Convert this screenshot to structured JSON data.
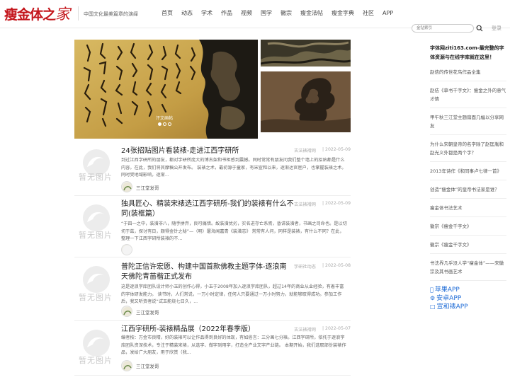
{
  "header": {
    "logo_main": "瘦金体之",
    "logo_ka": "家",
    "tagline": "中国文化最美篇章的演绎",
    "nav": [
      "首页",
      "动态",
      "学术",
      "作品",
      "视频",
      "国学",
      "徽宗",
      "瘦金法帖",
      "瘦金字典",
      "社区",
      "APP"
    ],
    "search_placeholder": "金钻索引",
    "login": "登录"
  },
  "banner": {
    "caption": "汗文画帖"
  },
  "articles": [
    {
      "title": "24张招贴图片看装裱-走进江西字研所",
      "source": "古法裱褙网",
      "date": "| 2022-05-09",
      "excerpt": "到过江西字研所的朋友，都对字研所庞大的博古架和书柜感到震撼。同时常常有朋友问我们整个墙上的招贴都是什么内容。在此，我们将其摩稿公开发布。 装裱之术，最初源于童家，有宋宣和以来，逐渐达官宦户，也掌握装裱之术。同时受地域影响，逐渐...",
      "author": "三江堂发哥",
      "thumb_text": "暂无图片"
    },
    {
      "title": "独具匠心、精装宋裱选江西字研所-我们的装裱有什么不同(装框篇）",
      "source": "古法裱褙网",
      "date": "| 2022-05-09",
      "excerpt": "“于四一之中，装潢非八，随手拼弃，良可痛惜。故装潢优劣，实名进存亡系焉，昏讲装潢者，书画之司命也。是以切切于兹，探讨有日，颇得金针之秘”—（明）屠海闻嘉青《装潢志》 常常有人问，同样是装裱，有什么不同？在此，整理一下江西字研所装裱的不...",
      "author": "",
      "thumb_text": "暂无图片"
    },
    {
      "title": "普陀正信许宏愿、构建中国首款佛教主题字体-逐浪南天佛陀青苗楷正式发布",
      "source": "字研社动态",
      "date": "| 2022-05-08",
      "excerpt": "这是逐浪字库团队设计师小玉的创作心得，小玉于2008年加入逐浪字库团队，超过14年的商业从业经验，有着丰富的字体研发能力。 读书时，人们常说，一万小时定律，任何人只要通过一万小时努力，就能够取得成功。参加工作后，我又听资者说“试玉能烧七日久，...",
      "author": "三江堂发哥",
      "thumb_text": "暂无图片"
    },
    {
      "title": "江西字研所-装裱精品展（2022年春季版）",
      "source": "古法裱褙网",
      "date": "| 2022-05-07",
      "excerpt": "编者按：万金市良精，好的装裱可以让作品得到良好的体现，有如俗言：三分画七分裱。江西字研所，依托于逐浪字库团队资深技术，专注于精装宋裱，从选字、做字到用字，打造全产业文字产业链。 本期开始，我们选取部份装裱作品，发给广大朋友，用于欣赏（我...",
      "author": "三江堂发哥",
      "thumb_text": "暂无图片"
    }
  ],
  "sidebar": {
    "head": "字体网ziti163.com-最完整的字体资源与在线字库就在这里！",
    "items": [
      "赵佶的传世花鸟作品全集",
      "赵佶《草书千字文》：瘦金之外的意气才情",
      "甲午秋三江堂主题扇面几幅以分享网友",
      "为什么宋朝皇帝的名字除了赵匡胤和赵光义外都是两个字？",
      "2013年诗作《和同事卢七律一首》",
      "创造“瘦金体”的皇帝书法家是谁？",
      "瘦金体书法艺术",
      "徽宗《瘦金千字文》",
      "徽宗《瘦金千字文》",
      "书法界几乎没人学“瘦金体”——宋徽宗及其书画艺术"
    ],
    "apps": [
      {
        "icon": "apple-icon",
        "label": "苹果APP"
      },
      {
        "icon": "android-icon",
        "label": "安卓APP"
      },
      {
        "icon": "phone-icon",
        "label": "宣和裱APP"
      }
    ]
  }
}
